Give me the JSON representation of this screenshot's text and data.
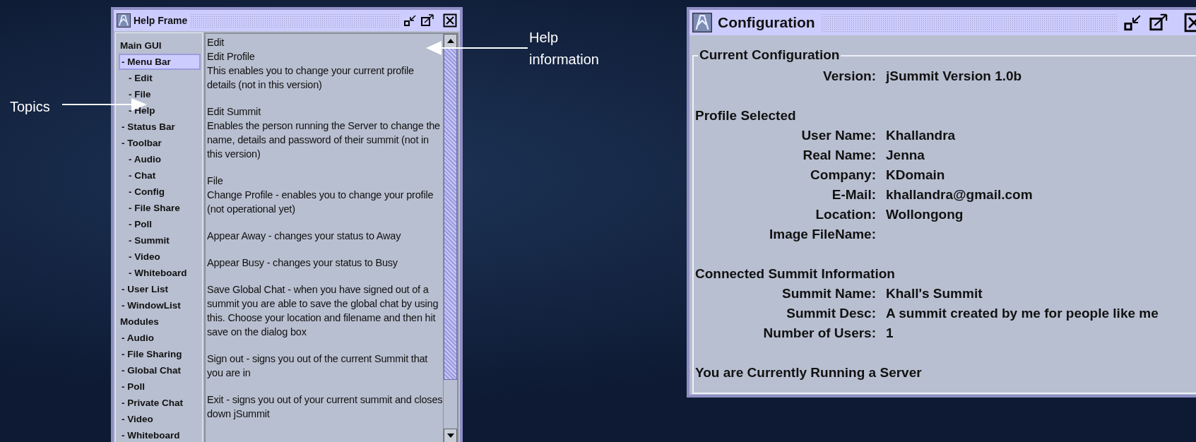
{
  "annotations": [
    {
      "text": "Topics",
      "kind": "rightward"
    },
    {
      "text": "Help information",
      "kind": "leftward"
    }
  ],
  "help_window": {
    "title": "Help Frame",
    "topics": [
      {
        "label": "Main GUI",
        "selected": false,
        "children": [
          {
            "label": "- Menu Bar",
            "selected": true,
            "children": [
              {
                "label": "- Edit",
                "selected": false
              },
              {
                "label": "- File",
                "selected": false
              },
              {
                "label": "- Help",
                "selected": false
              }
            ]
          },
          {
            "label": "- Status Bar",
            "selected": false
          },
          {
            "label": "- Toolbar",
            "selected": false,
            "children": [
              {
                "label": "- Audio",
                "selected": false
              },
              {
                "label": "- Chat",
                "selected": false
              },
              {
                "label": "- Config",
                "selected": false
              },
              {
                "label": "- File Share",
                "selected": false
              },
              {
                "label": "- Poll",
                "selected": false
              },
              {
                "label": "- Summit",
                "selected": false
              },
              {
                "label": "- Video",
                "selected": false
              },
              {
                "label": "- Whiteboard",
                "selected": false
              }
            ]
          },
          {
            "label": "- User List",
            "selected": false
          },
          {
            "label": "- WindowList",
            "selected": false
          }
        ]
      },
      {
        "label": "Modules",
        "selected": false,
        "children": [
          {
            "label": "- Audio",
            "selected": false
          },
          {
            "label": "- File Sharing",
            "selected": false
          },
          {
            "label": "- Global Chat",
            "selected": false
          },
          {
            "label": "- Poll",
            "selected": false
          },
          {
            "label": "- Private Chat",
            "selected": false
          },
          {
            "label": "- Video",
            "selected": false
          },
          {
            "label": "- Whiteboard",
            "selected": false
          }
        ]
      }
    ],
    "paragraphs": [
      [
        "Edit",
        "Edit Profile",
        "This enables you to change your current profile details (not in this version)"
      ],
      [
        "Edit Summit",
        "Enables the person running the Server to change the name, details and password of their summit (not in this version)"
      ],
      [
        "File",
        "Change Profile - enables you to change your profile (not operational yet)"
      ],
      [
        "Appear Away - changes your status to Away"
      ],
      [
        "Appear Busy - changes your status to Busy"
      ],
      [
        "Save Global Chat - when you have signed out of a summit you are able to save the global chat by using this. Choose your location and filename and then hit save on the dialog box"
      ],
      [
        "Sign out - signs you out of the current Summit that you are in"
      ],
      [
        "Exit - signs you out of your current summit and closes down jSummit"
      ]
    ]
  },
  "config_window": {
    "title": "Configuration",
    "group_title": "Current Configuration",
    "sections": [
      {
        "fields": [
          {
            "label": "Version:",
            "value": "jSummit Version 1.0b"
          }
        ]
      },
      {
        "heading": "Profile Selected",
        "fields": [
          {
            "label": "User Name:",
            "value": "Khallandra"
          },
          {
            "label": "Real Name:",
            "value": "Jenna"
          },
          {
            "label": "Company:",
            "value": "KDomain"
          },
          {
            "label": "E-Mail:",
            "value": "khallandra@gmail.com"
          },
          {
            "label": "Location:",
            "value": "Wollongong"
          },
          {
            "label": "Image FileName:"
          }
        ]
      },
      {
        "heading": "Connected Summit Information",
        "fields": [
          {
            "label": "Summit Name:",
            "value": "Khall's Summit"
          },
          {
            "label": "Summit Desc:",
            "value": "A summit created by me for people like me"
          },
          {
            "label": "Number of Users:",
            "value": "1"
          }
        ]
      }
    ],
    "status": "You are Currently Running a Server"
  }
}
